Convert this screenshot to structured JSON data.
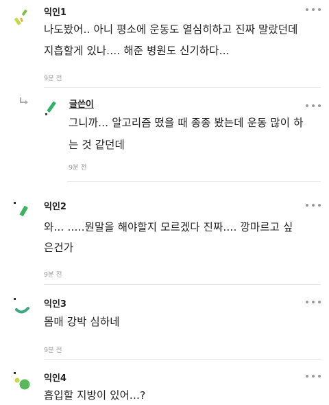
{
  "comments": [
    {
      "author": "익인1",
      "lines": [
        "나도봤어.. 아니 평소에 운동도 열심히하고 진짜 말랐던데",
        "지흡할게 있나.... 해준 병원도 신기하다..."
      ],
      "time": "9분 전",
      "avatar_icon": "confetti-avatar-icon",
      "avatar_colors": [
        "#c7d94a",
        "#7cc242",
        "#e0b13a"
      ]
    },
    {
      "author": "글쓴이",
      "is_reply": true,
      "lines": [
        "그니까... 알고리즘 떴을 때 종종 봤는데 운동 많이 하",
        "는 것 같던데"
      ],
      "time": "9분 전",
      "avatar_icon": "slash-avatar-icon",
      "avatar_colors": [
        "#2fb36a",
        "#444444"
      ]
    },
    {
      "author": "익인2",
      "lines": [
        "와... .....뭔말을 해야할지 모르겠다 진짜.... 깡마르고 싶",
        "은건가"
      ],
      "time": "9분 전",
      "avatar_icon": "slash-avatar-icon",
      "avatar_colors": [
        "#3cb35c",
        "#333333"
      ]
    },
    {
      "author": "익인3",
      "lines": [
        "몸매 강박 심하네"
      ],
      "time": "9분 전",
      "avatar_icon": "arc-avatar-icon",
      "avatar_colors": [
        "#3aa87a",
        "#333333"
      ]
    },
    {
      "author": "익인4",
      "lines": [
        "흡입할 지방이 있어...?"
      ],
      "time": "",
      "avatar_icon": "dots-avatar-icon",
      "avatar_colors": [
        "#5cb85c",
        "#c7d94a",
        "#333333"
      ]
    }
  ]
}
